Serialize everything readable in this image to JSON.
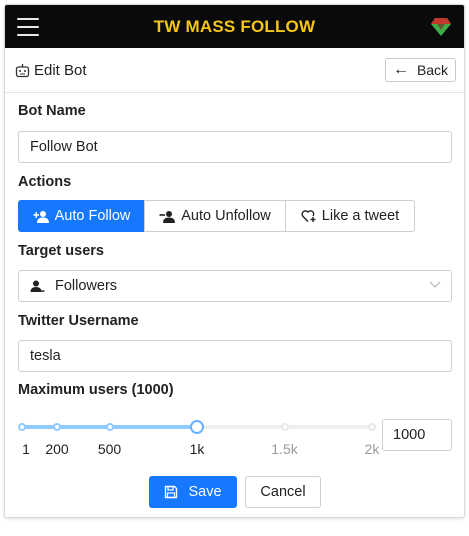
{
  "app": {
    "title": "TW MASS FOLLOW"
  },
  "colors": {
    "topbar": "#0a0a0a",
    "title": "#f5c518",
    "primary": "#1677ff",
    "slider_track": "#91caff"
  },
  "header": {
    "title": "Edit Bot",
    "back_label": "Back"
  },
  "form": {
    "bot_name": {
      "label": "Bot Name",
      "value": "Follow Bot"
    },
    "actions": {
      "label": "Actions",
      "options": [
        {
          "label": "Auto Follow",
          "icon": "user-add-icon",
          "selected": true
        },
        {
          "label": "Auto Unfollow",
          "icon": "user-remove-icon",
          "selected": false
        },
        {
          "label": "Like a tweet",
          "icon": "heart-plus-icon",
          "selected": false
        }
      ]
    },
    "target_users": {
      "label": "Target users",
      "selected": "Followers",
      "icon": "user-icon"
    },
    "twitter_username": {
      "label": "Twitter Username",
      "value": "tesla"
    },
    "max_users": {
      "label": "Maximum users (1000)",
      "value": 1000,
      "input_value": "1000",
      "marks": [
        "1",
        "200",
        "500",
        "1k",
        "1.5k",
        "2k"
      ],
      "mark_values": [
        1,
        200,
        500,
        1000,
        1500,
        2000
      ],
      "max": 2000
    },
    "save_label": "Save",
    "cancel_label": "Cancel"
  }
}
